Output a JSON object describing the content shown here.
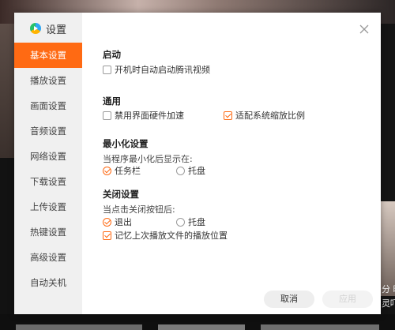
{
  "dialog": {
    "title": "设置",
    "close_icon": "close-icon",
    "accent_color": "#ff6a13"
  },
  "sidebar": {
    "items": [
      {
        "label": "基本设置",
        "active": true
      },
      {
        "label": "播放设置"
      },
      {
        "label": "画面设置"
      },
      {
        "label": "音频设置"
      },
      {
        "label": "网络设置"
      },
      {
        "label": "下载设置"
      },
      {
        "label": "上传设置"
      },
      {
        "label": "热键设置"
      },
      {
        "label": "高级设置"
      },
      {
        "label": "自动关机"
      }
    ]
  },
  "sections": {
    "startup": {
      "title": "启动",
      "autostart": {
        "label": "开机时自动启动腾讯视频",
        "checked": false
      }
    },
    "general": {
      "title": "通用",
      "hw_accel": {
        "label": "禁用界面硬件加速",
        "checked": false
      },
      "scaling": {
        "label": "适配系统缩放比例",
        "checked": true
      }
    },
    "minimize": {
      "title": "最小化设置",
      "prompt": "当程序最小化后显示在:",
      "taskbar": {
        "label": "任务栏",
        "checked": true
      },
      "tray": {
        "label": "托盘",
        "checked": false
      }
    },
    "close": {
      "title": "关闭设置",
      "prompt": "当点击关闭按钮后:",
      "exit": {
        "label": "退出",
        "checked": true
      },
      "tray": {
        "label": "托盘",
        "checked": false
      },
      "remember_pos": {
        "label": "记忆上次播放文件的播放位置",
        "checked": true
      }
    }
  },
  "buttons": {
    "cancel": "取消",
    "apply": "应用"
  },
  "background": {
    "right_text": "分 晚\n灵吓"
  }
}
